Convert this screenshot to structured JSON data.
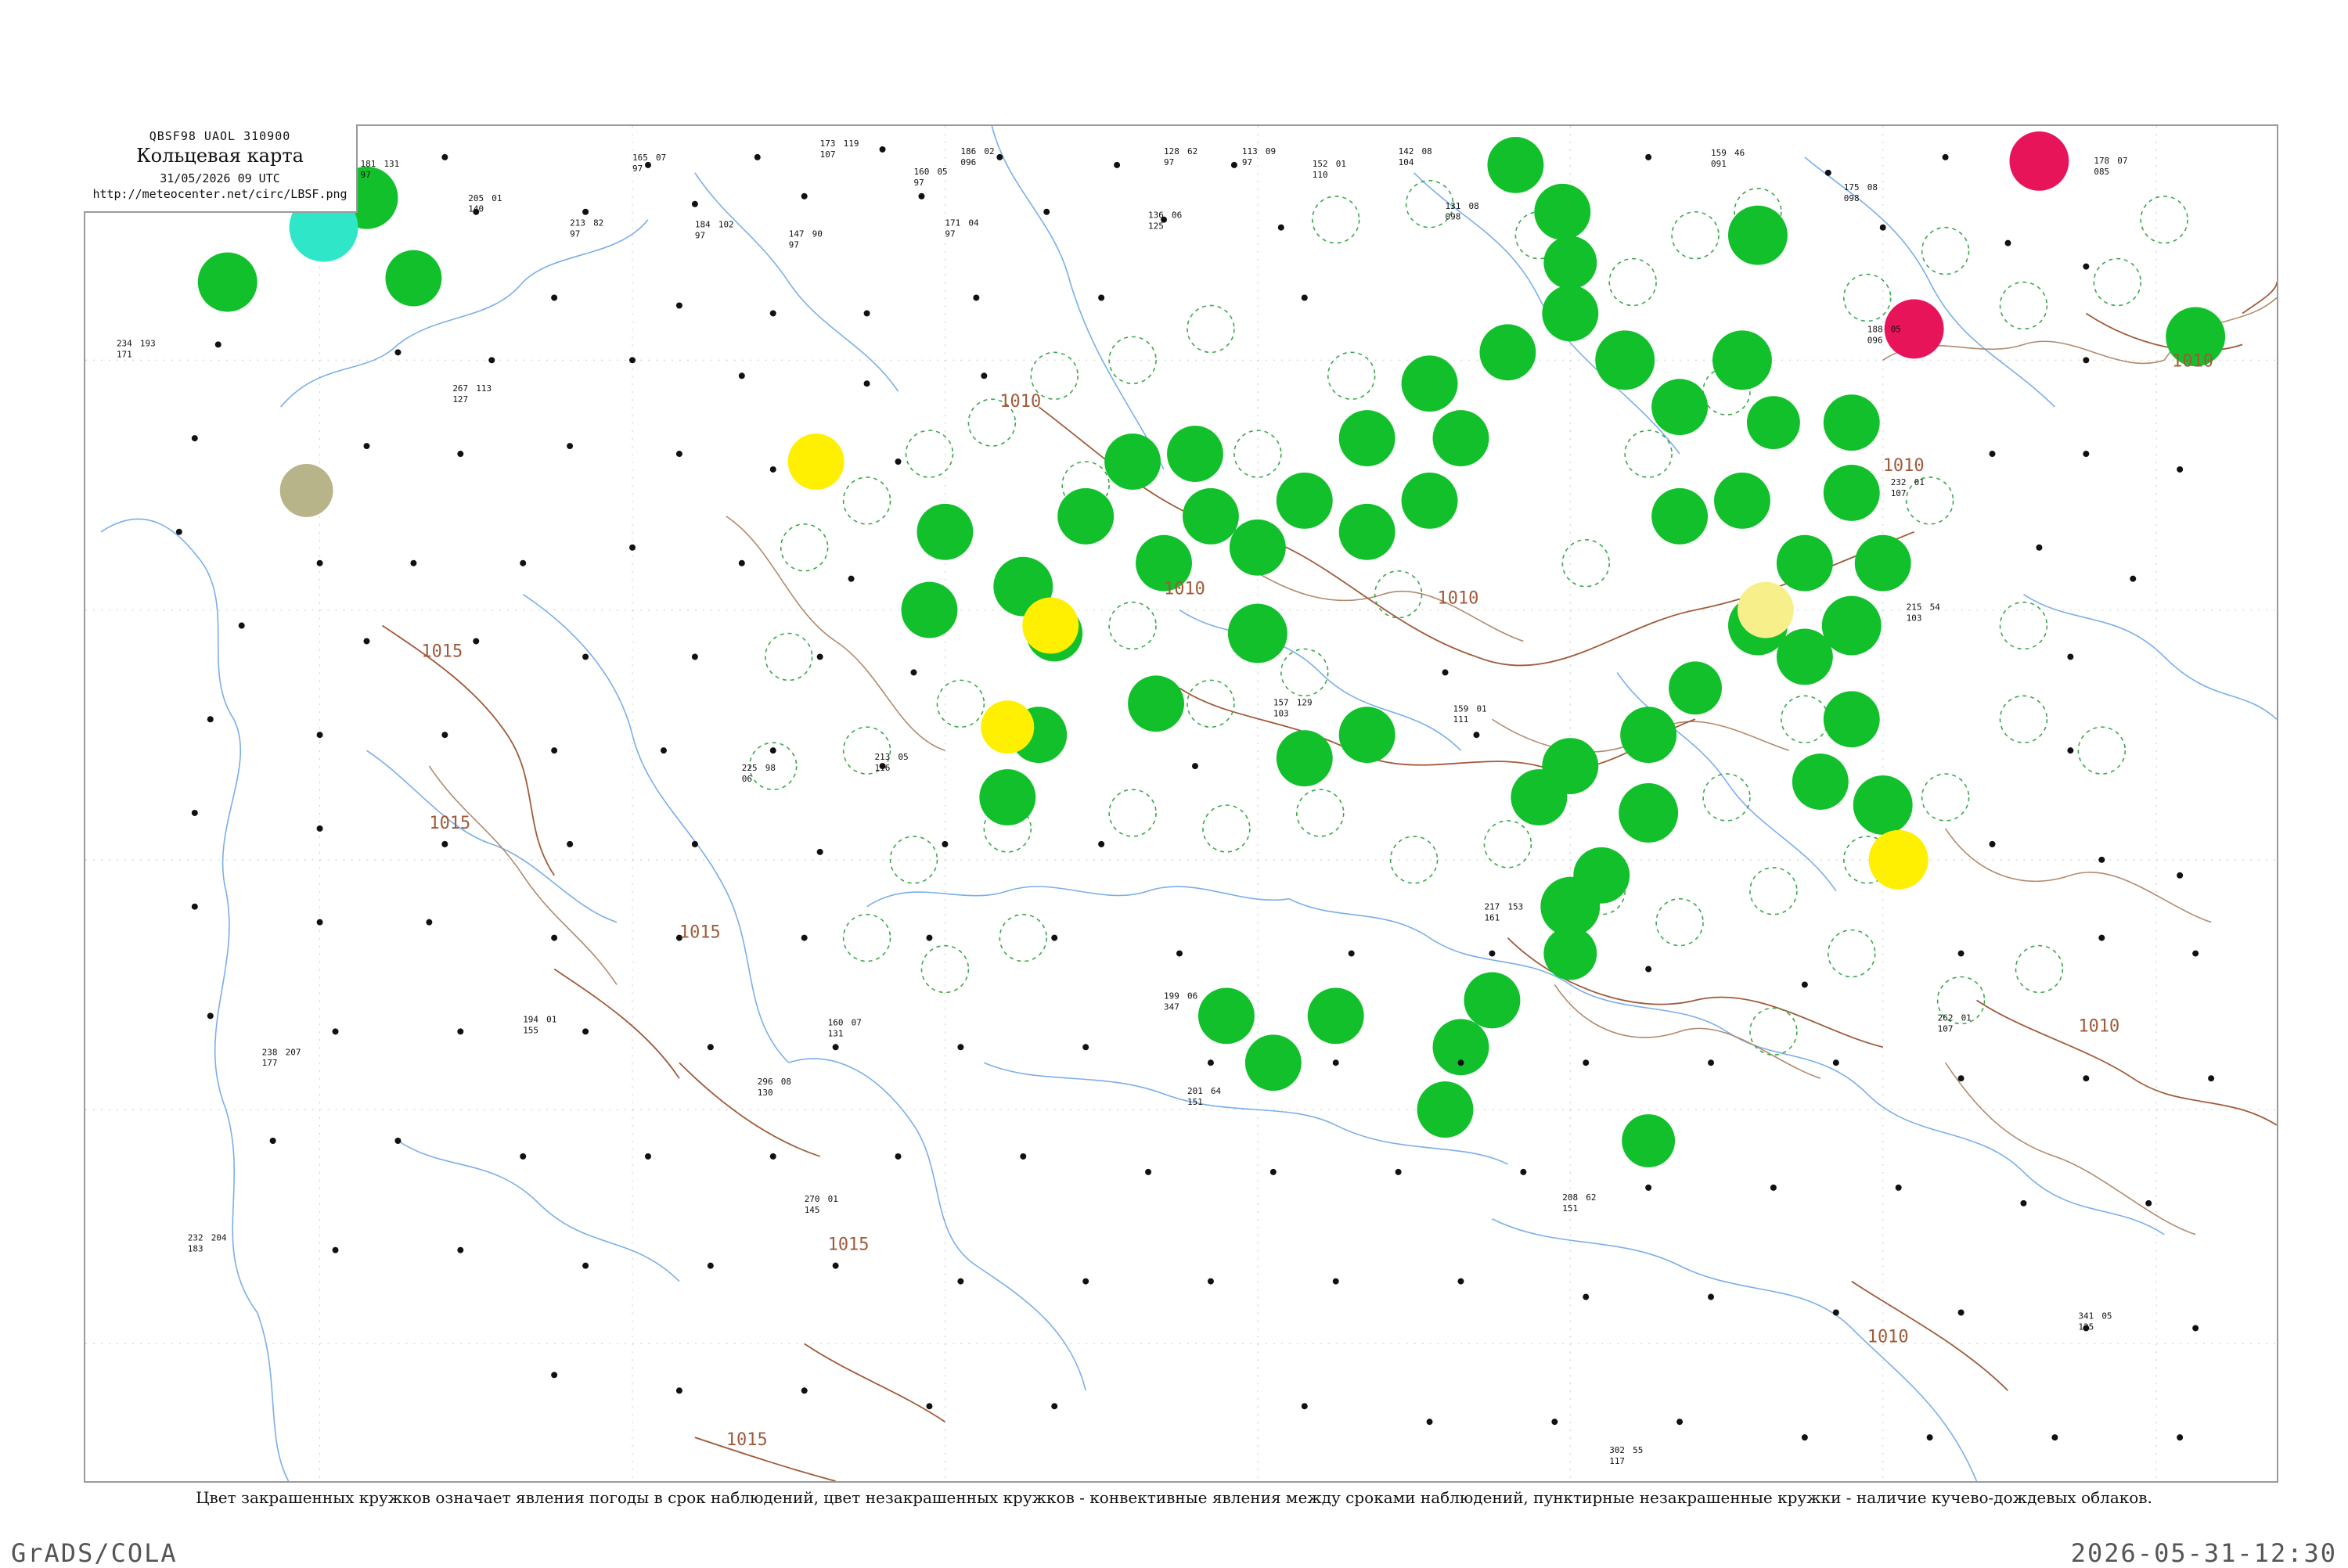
{
  "header": {
    "code": "QBSF98  UAOL  310900",
    "title": "Кольцевая карта",
    "date": "31/05/2026 09 UTC",
    "url": "http://meteocenter.net/circ/LBSF.png"
  },
  "caption": "Цвет закрашенных кружков означает явления погоды в срок наблюдений, цвет незакрашенных кружков - конвективные явления между сроками наблюдений, пунктирные незакрашенные кружки - наличие кучево-дождевых облаков.",
  "footer": {
    "left": "GrADS/COLA",
    "right": "2026-05-31-12:30"
  },
  "isobars": [
    {
      "label": "1010"
    },
    {
      "label": "1010"
    },
    {
      "label": "1010"
    },
    {
      "label": "1010"
    },
    {
      "label": "1010"
    },
    {
      "label": "1010"
    },
    {
      "label": "1010"
    },
    {
      "label": "1015"
    },
    {
      "label": "1015"
    },
    {
      "label": "1015"
    },
    {
      "label": "1015"
    },
    {
      "label": "1015"
    }
  ],
  "colors": {
    "thunderstorm": "#11c02a",
    "rain_shower": "#ffef00",
    "drizzle": "#f7f08a",
    "heavy": "#e8145a",
    "snow": "#2fe6c8",
    "fog": "#b8b48a",
    "cb_dashed": "#3aa84a",
    "isobar": "#a05a3a",
    "coast": "#7aaeea",
    "border": "#b08a6e"
  },
  "stations": [
    {
      "p": "181",
      "t": "97",
      "d": "131"
    },
    {
      "p": "165",
      "t": "97",
      "d": "07"
    },
    {
      "p": "173",
      "t": "107",
      "d": "119"
    },
    {
      "p": "160",
      "t": "97",
      "d": "05"
    },
    {
      "p": "128",
      "t": "97",
      "d": "62"
    },
    {
      "p": "113",
      "t": "97",
      "d": "09"
    },
    {
      "p": "142",
      "t": "104",
      "d": "08"
    },
    {
      "p": "159",
      "t": "091",
      "d": "46"
    },
    {
      "p": "175",
      "t": "098",
      "d": "08"
    },
    {
      "p": "178",
      "t": "085",
      "d": "07"
    },
    {
      "p": "205",
      "t": "140",
      "d": "01"
    },
    {
      "p": "213",
      "t": "97",
      "d": "82"
    },
    {
      "p": "184",
      "t": "97",
      "d": "102"
    },
    {
      "p": "147",
      "t": "97",
      "d": "90"
    },
    {
      "p": "171",
      "t": "97",
      "d": "04"
    },
    {
      "p": "186",
      "t": "096",
      "d": "02"
    },
    {
      "p": "152",
      "t": "110",
      "d": "01"
    },
    {
      "p": "131",
      "t": "098",
      "d": "08"
    },
    {
      "p": "136",
      "t": "125",
      "d": "06"
    },
    {
      "p": "160",
      "t": "131",
      "d": "07"
    },
    {
      "p": "194",
      "t": "155",
      "d": "01"
    },
    {
      "p": "225",
      "t": "06",
      "d": "98"
    },
    {
      "p": "217",
      "t": "161",
      "d": "153"
    },
    {
      "p": "232",
      "t": "183",
      "d": "204"
    },
    {
      "p": "199",
      "t": "347",
      "d": "06"
    },
    {
      "p": "201",
      "t": "151",
      "d": "64"
    },
    {
      "p": "208",
      "t": "151",
      "d": "62"
    },
    {
      "p": "238",
      "t": "177",
      "d": "207"
    },
    {
      "p": "267",
      "t": "127",
      "d": "113"
    },
    {
      "p": "234",
      "t": "171",
      "d": "193"
    },
    {
      "p": "296",
      "t": "130",
      "d": "08"
    },
    {
      "p": "213",
      "t": "116",
      "d": "05"
    },
    {
      "p": "157",
      "t": "103",
      "d": "129"
    },
    {
      "p": "159",
      "t": "111",
      "d": "01"
    },
    {
      "p": "262",
      "t": "107",
      "d": "01"
    },
    {
      "p": "188",
      "t": "096",
      "d": "05"
    },
    {
      "p": "232",
      "t": "107",
      "d": "01"
    },
    {
      "p": "215",
      "t": "103",
      "d": "54"
    },
    {
      "p": "270",
      "t": "145",
      "d": "01"
    },
    {
      "p": "341",
      "t": "125",
      "d": "05"
    },
    {
      "p": "302",
      "t": "117",
      "d": "55"
    }
  ]
}
